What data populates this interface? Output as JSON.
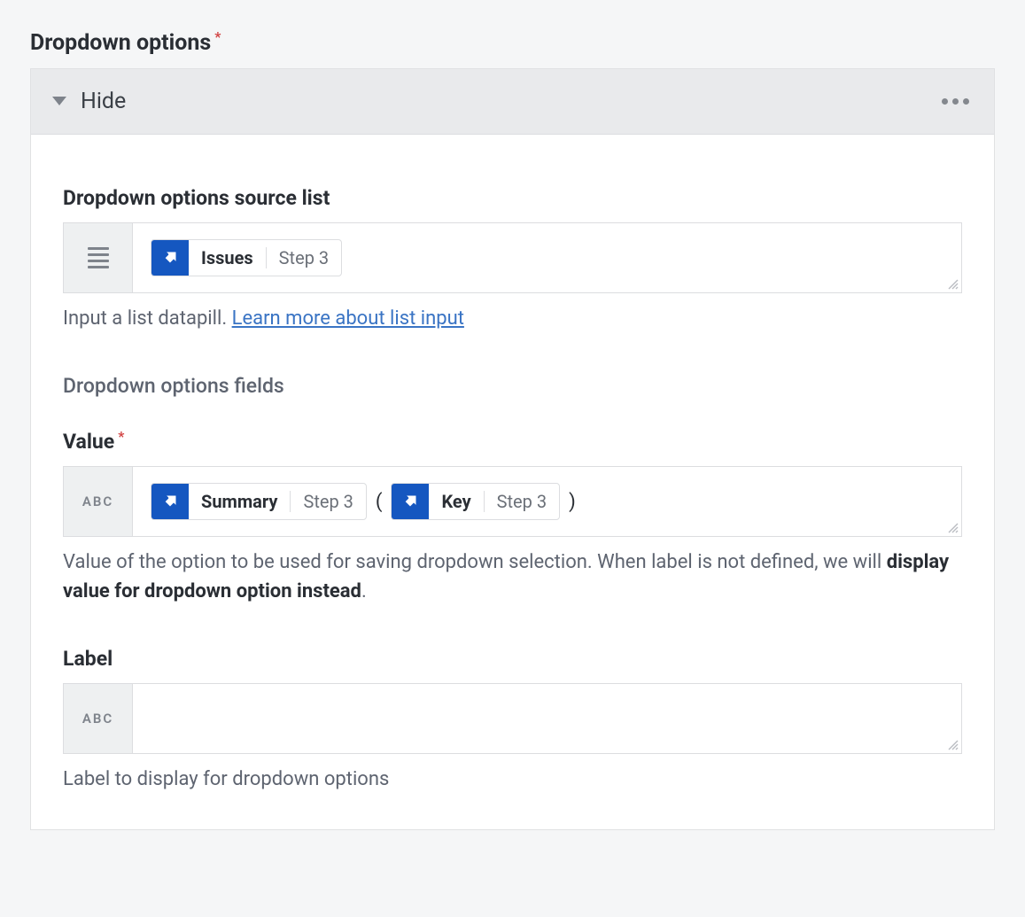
{
  "title": "Dropdown options",
  "panel": {
    "toggle_label": "Hide"
  },
  "source_list": {
    "label": "Dropdown options source list",
    "help_prefix": "Input a list datapill. ",
    "help_link_text": "Learn more about list input",
    "pill": {
      "label": "Issues",
      "step": "Step 3"
    }
  },
  "fields_heading": "Dropdown options fields",
  "value_field": {
    "label": "Value",
    "type_badge": "ABC",
    "pill1": {
      "label": "Summary",
      "step": "Step 3"
    },
    "pill2": {
      "label": "Key",
      "step": "Step 3"
    },
    "open_paren": "(",
    "close_paren": ")",
    "help_prefix": "Value of the option to be used for saving dropdown selection. When label is not defined, we will ",
    "help_strong": "display value for dropdown option instead",
    "help_suffix": "."
  },
  "label_field": {
    "label": "Label",
    "type_badge": "ABC",
    "help": "Label to display for dropdown options"
  }
}
